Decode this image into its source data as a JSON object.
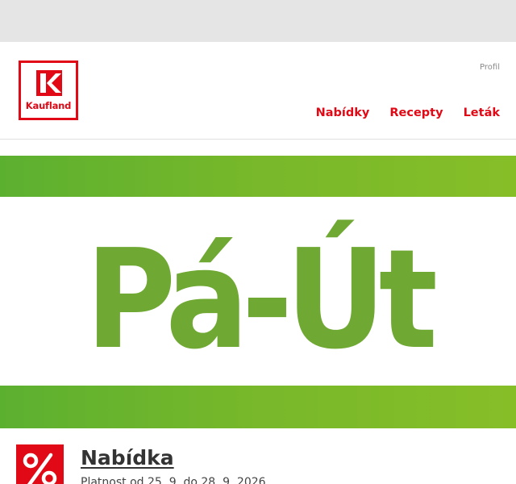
{
  "header": {
    "logo_text": "Kaufland",
    "profile_label": "Profil",
    "nav": [
      {
        "label": "Nabídky"
      },
      {
        "label": "Recepty"
      },
      {
        "label": "Leták"
      }
    ]
  },
  "banner": {
    "headline": "Pá-Út",
    "color": "#6fa832",
    "stripe_color": "#78b82a"
  },
  "offer": {
    "icon": "percent-icon",
    "title": "Nabídka",
    "validity": "Platnost od 25. 9. do 28. 9. 2026"
  },
  "colors": {
    "brand": "#e10915",
    "topbar": "#e5e5e5"
  }
}
